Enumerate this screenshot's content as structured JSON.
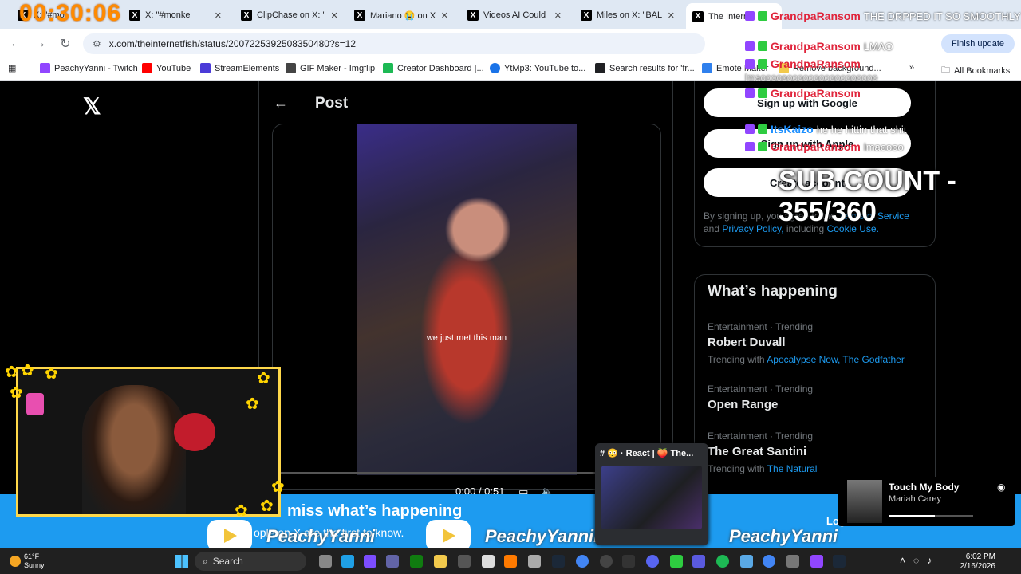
{
  "browser": {
    "tabs": [
      {
        "label": "X: \"#mo"
      },
      {
        "label": "X: \"#monke"
      },
      {
        "label": "ClipChase on X: \""
      },
      {
        "label": "Mariano 😭 on X"
      },
      {
        "label": "Videos AI Could"
      },
      {
        "label": "Miles on X: \"BAL"
      },
      {
        "label": "The Interne"
      }
    ],
    "url": "x.com/theinternetfish/status/2007225392508350480?s=12",
    "finish_update": "Finish update",
    "bookmarks": [
      {
        "label": "PeachyYanni - Twitch",
        "color": "#9146ff"
      },
      {
        "label": "YouTube",
        "color": "#ff0000"
      },
      {
        "label": "StreamElements",
        "color": "#4b3bd8"
      },
      {
        "label": "GIF Maker - Imgflip",
        "color": "#444444"
      },
      {
        "label": "Creator Dashboard |...",
        "color": "#1db954"
      },
      {
        "label": "YtMp3: YouTube to...",
        "color": "#1a73e8"
      },
      {
        "label": "Search results for 'fr...",
        "color": "#202124"
      },
      {
        "label": "Emote Maker",
        "color": "#2f80ed"
      },
      {
        "label": "Remove background...",
        "color": "#f2c94c"
      }
    ],
    "all_bookmarks": "All Bookmarks"
  },
  "x_page": {
    "post_title": "Post",
    "video_caption": "we just met this man",
    "video_time": "0:00 / 0:51",
    "signup_google": "Sign up with Google",
    "signup_apple": "Sign up with Apple",
    "create_account": "Create account",
    "terms_prefix": "By signing up, you agree to the",
    "terms_link": "Terms of Service",
    "terms_and": "and",
    "privacy_link": "Privacy Policy,",
    "including": "including",
    "cookie_link": "Cookie Use.",
    "happening_title": "What’s happening",
    "trends": [
      {
        "meta": "Entertainment · Trending",
        "name": "Robert Duvall",
        "with_label": "Trending with",
        "with": "Apocalypse Now, The Godfather"
      },
      {
        "meta": "Entertainment · Trending",
        "name": "Open Range",
        "with_label": "",
        "with": ""
      },
      {
        "meta": "Entertainment · Trending",
        "name": "The Great Santini",
        "with_label": "Trending with",
        "with": "The Natural"
      }
    ],
    "banner_title": "miss what’s happening",
    "banner_sub": "ople on X are the first to know.",
    "login": "Log"
  },
  "overlay": {
    "timer": "00:30:06",
    "sub_count": "SUB COUNT - 355/360",
    "chat": [
      {
        "user": "GrandpaRansom",
        "msg": "THE DRPPED IT SO SMOOTHLY",
        "color": "red"
      },
      {
        "user": "GrandpaRansom",
        "msg": "LMAO",
        "color": "red"
      },
      {
        "user": "GrandpaRansom",
        "msg": "lmaoooooooooooooooooooooo",
        "color": "red"
      },
      {
        "user": "GrandpaRansom",
        "msg": "",
        "color": "red"
      },
      {
        "user": "ItsKaizo",
        "msg": "he he hittin that shit",
        "color": "blue"
      },
      {
        "user": "GrandpaRansom",
        "msg": "lmaoooo",
        "color": "red"
      }
    ],
    "brand_left": "PeachyYanni",
    "brand_mid": "PeachyYanniLive",
    "brand_right": "PeachyYanni"
  },
  "discord": {
    "title": "# 😳 · React | 🍑 The..."
  },
  "spotify": {
    "song": "Touch My Body",
    "artist": "Mariah Carey",
    "progress": 0.55
  },
  "taskbar": {
    "temp": "61°F",
    "condition": "Sunny",
    "search": "Search",
    "time": "6:02 PM",
    "date": "2/16/2026"
  },
  "colors": {
    "accent": "#1d9bf0",
    "timer": "#ff8a00",
    "chat_red": "#e0243b"
  }
}
